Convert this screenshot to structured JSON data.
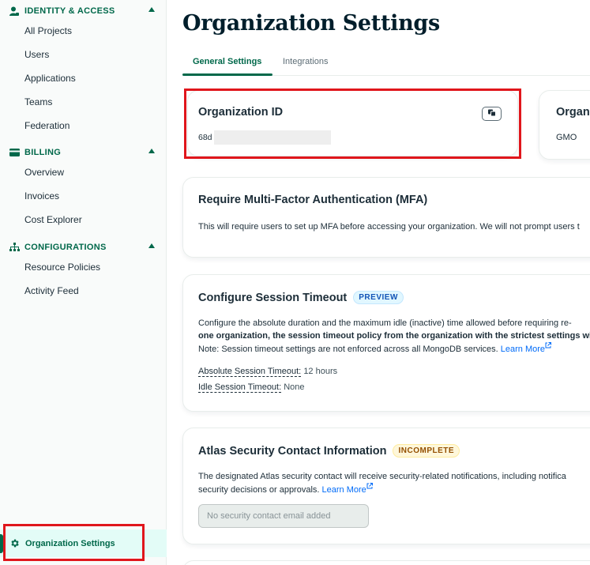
{
  "sidebar": {
    "sections": [
      {
        "title": "IDENTITY & ACCESS",
        "icon": "person-icon",
        "items": [
          "All Projects",
          "Users",
          "Applications",
          "Teams",
          "Federation"
        ]
      },
      {
        "title": "BILLING",
        "icon": "credit-card-icon",
        "items": [
          "Overview",
          "Invoices",
          "Cost Explorer"
        ]
      },
      {
        "title": "CONFIGURATIONS",
        "icon": "hierarchy-icon",
        "items": [
          "Resource Policies",
          "Activity Feed"
        ]
      }
    ],
    "active_item": "Organization Settings"
  },
  "page": {
    "title": "Organization Settings",
    "tabs": [
      "General Settings",
      "Integrations"
    ],
    "active_tab": "General Settings"
  },
  "org_id_card": {
    "title": "Organization ID",
    "value_prefix": "68d"
  },
  "org_name_card": {
    "title_partial": "Organ",
    "value": "GMO"
  },
  "mfa_card": {
    "title": "Require Multi-Factor Authentication (MFA)",
    "description": "This will require users to set up MFA before accessing your organization. We will not prompt users t"
  },
  "session_card": {
    "title": "Configure Session Timeout",
    "badge": "PREVIEW",
    "line1": "Configure the absolute duration and the maximum idle (inactive) time allowed before requiring re-",
    "line2": "one organization, the session timeout policy from the organization with the strictest settings wil",
    "line3": "Note: Session timeout settings are not enforced across all MongoDB services.",
    "learn_more": "Learn More",
    "absolute_label": "Absolute Session Timeout:",
    "absolute_value": "12 hours",
    "idle_label": "Idle Session Timeout:",
    "idle_value": "None"
  },
  "security_card": {
    "title": "Atlas Security Contact Information",
    "badge": "INCOMPLETE",
    "line1": "The designated Atlas security contact will receive security-related notifications, including notifica",
    "line2": "security decisions or approvals.",
    "learn_more": "Learn More",
    "email_placeholder": "No security contact email added"
  },
  "colors": {
    "brand_green": "#00684a",
    "link_blue": "#016bf8",
    "highlight_red": "#e0161c"
  }
}
